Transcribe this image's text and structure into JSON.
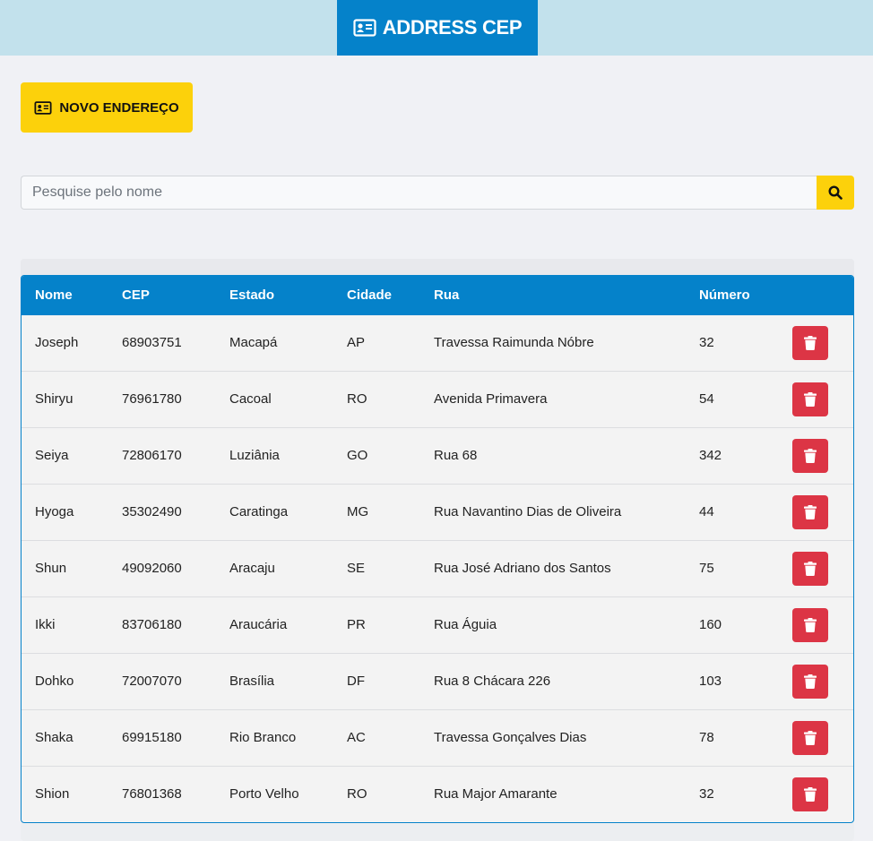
{
  "header": {
    "title": "ADDRESS CEP",
    "icon": "id-card-icon",
    "bg_color": "#c2e1ec",
    "accent_color": "#0582ca"
  },
  "actions": {
    "new_address_label": "NOVO ENDEREÇO",
    "new_address_color": "#fcd10b"
  },
  "search": {
    "placeholder": "Pesquise pelo nome",
    "value": "",
    "button_icon": "search-icon"
  },
  "table": {
    "columns": [
      "Nome",
      "CEP",
      "Estado",
      "Cidade",
      "Rua",
      "Número"
    ],
    "delete_button_color": "#dc3545",
    "rows": [
      {
        "nome": "Joseph",
        "cep": "68903751",
        "estado": "Macapá",
        "cidade": "AP",
        "rua": "Travessa Raimunda Nóbre",
        "numero": "32"
      },
      {
        "nome": "Shiryu",
        "cep": "76961780",
        "estado": "Cacoal",
        "cidade": "RO",
        "rua": "Avenida Primavera",
        "numero": "54"
      },
      {
        "nome": "Seiya",
        "cep": "72806170",
        "estado": "Luziânia",
        "cidade": "GO",
        "rua": "Rua 68",
        "numero": "342"
      },
      {
        "nome": "Hyoga",
        "cep": "35302490",
        "estado": "Caratinga",
        "cidade": "MG",
        "rua": "Rua Navantino Dias de Oliveira",
        "numero": "44"
      },
      {
        "nome": "Shun",
        "cep": "49092060",
        "estado": "Aracaju",
        "cidade": "SE",
        "rua": "Rua José Adriano dos Santos",
        "numero": "75"
      },
      {
        "nome": "Ikki",
        "cep": "83706180",
        "estado": "Araucária",
        "cidade": "PR",
        "rua": "Rua Águia",
        "numero": "160"
      },
      {
        "nome": "Dohko",
        "cep": "72007070",
        "estado": "Brasília",
        "cidade": "DF",
        "rua": "Rua 8 Chácara 226",
        "numero": "103"
      },
      {
        "nome": "Shaka",
        "cep": "69915180",
        "estado": "Rio Branco",
        "cidade": "AC",
        "rua": "Travessa Gonçalves Dias",
        "numero": "78"
      },
      {
        "nome": "Shion",
        "cep": "76801368",
        "estado": "Porto Velho",
        "cidade": "RO",
        "rua": "Rua Major Amarante",
        "numero": "32"
      }
    ]
  }
}
